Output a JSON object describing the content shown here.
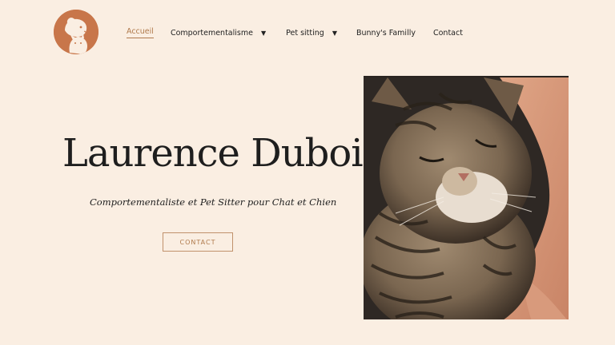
{
  "nav": {
    "items": [
      {
        "label": "Accueil"
      },
      {
        "label": "Comportementalisme"
      },
      {
        "label": "Pet sitting"
      },
      {
        "label": "Bunny's Familly"
      },
      {
        "label": "Contact"
      }
    ]
  },
  "hero": {
    "title": "Laurence Dubois",
    "subtitle": "Comportementaliste et Pet Sitter pour Chat et Chien",
    "cta_label": "CONTACT"
  },
  "colors": {
    "background": "#faeee2",
    "brand": "#c8764a",
    "accent": "#b07a4c"
  },
  "icons": {
    "logo": "dog-and-cat-logo",
    "dropdown": "caret-down-icon"
  }
}
